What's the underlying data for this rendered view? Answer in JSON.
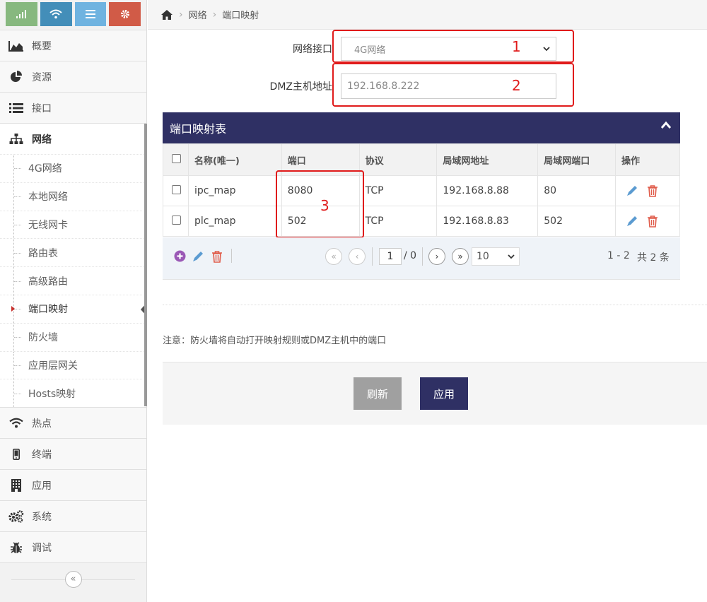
{
  "top_buttons": [
    {
      "icon": "signal-icon",
      "color": "#87b87f"
    },
    {
      "icon": "wifi-icon",
      "color": "#438eb9"
    },
    {
      "icon": "list-icon",
      "color": "#6fb3e0"
    },
    {
      "icon": "gear-icon",
      "color": "#d15b47"
    }
  ],
  "sidebar": {
    "items": [
      {
        "label": "概要",
        "icon": "area-chart-icon"
      },
      {
        "label": "资源",
        "icon": "pie-chart-icon"
      },
      {
        "label": "接口",
        "icon": "list-icon"
      },
      {
        "label": "网络",
        "icon": "sitemap-icon"
      },
      {
        "label": "热点",
        "icon": "wifi-icon"
      },
      {
        "label": "终端",
        "icon": "mobile-icon"
      },
      {
        "label": "应用",
        "icon": "building-icon"
      },
      {
        "label": "系统",
        "icon": "cogs-icon"
      },
      {
        "label": "调试",
        "icon": "bug-icon"
      }
    ],
    "network_sub": [
      "4G网络",
      "本地网络",
      "无线网卡",
      "路由表",
      "高级路由",
      "端口映射",
      "防火墙",
      "应用层网关",
      "Hosts映射"
    ],
    "active_sub": "端口映射",
    "collapse_glyph": "«"
  },
  "breadcrumb": {
    "home": "home-icon",
    "items": [
      "网络",
      "端口映射"
    ]
  },
  "form": {
    "iface_label": "网络接口",
    "iface_value": "4G网络",
    "dmz_label": "DMZ主机地址",
    "dmz_value": "192.168.8.222"
  },
  "annotations": [
    "1",
    "2",
    "3"
  ],
  "table": {
    "title": "端口映射表",
    "columns": [
      "名称(唯一)",
      "端口",
      "协议",
      "局域网地址",
      "局域网端口",
      "操作"
    ],
    "rows": [
      {
        "name": "ipc_map",
        "port": "8080",
        "proto": "TCP",
        "lan_ip": "192.168.8.88",
        "lan_port": "80"
      },
      {
        "name": "plc_map",
        "port": "502",
        "proto": "TCP",
        "lan_ip": "192.168.8.83",
        "lan_port": "502"
      }
    ]
  },
  "pager": {
    "page": "1",
    "total_pages": "/ 0",
    "page_size": "10",
    "range": "1 - 2",
    "total": "共 2 条"
  },
  "note": "注意：防火墙将自动打开映射规则或DMZ主机中的端口",
  "buttons": {
    "refresh": "刷新",
    "apply": "应用"
  },
  "colors": {
    "accent": "#2f3064",
    "refresh_bg": "#a0a0a0",
    "annotation_red": "#e01b1b"
  }
}
